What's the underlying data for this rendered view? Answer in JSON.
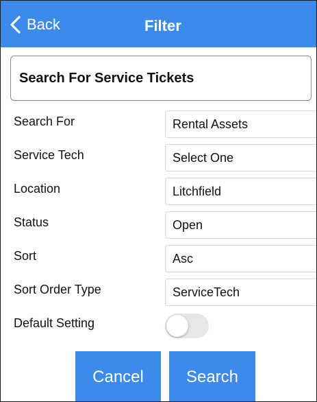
{
  "header": {
    "back_label": "Back",
    "title": "Filter",
    "back_icon": "chevron-left-icon",
    "bg_color": "#3c8bea"
  },
  "section": {
    "title": "Search For Service Tickets"
  },
  "form": {
    "rows": [
      {
        "label": "Search For",
        "value": "Rental Assets"
      },
      {
        "label": "Service Tech",
        "value": "Select One"
      },
      {
        "label": "Location",
        "value": "Litchfield"
      },
      {
        "label": "Status",
        "value": "Open"
      },
      {
        "label": "Sort",
        "value": "Asc"
      },
      {
        "label": "Sort Order Type",
        "value": "ServiceTech"
      }
    ],
    "default_setting": {
      "label": "Default Setting",
      "enabled": false
    }
  },
  "buttons": {
    "cancel_label": "Cancel",
    "search_label": "Search",
    "color": "#3c8bea"
  }
}
